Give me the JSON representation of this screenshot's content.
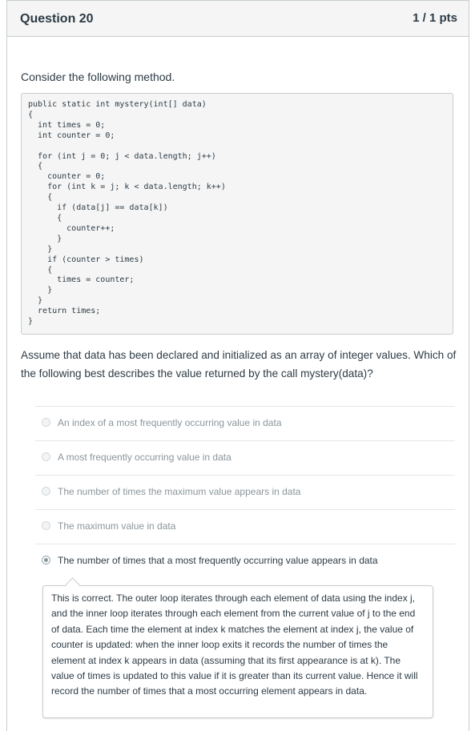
{
  "header": {
    "title": "Question 20",
    "points": "1 / 1 pts"
  },
  "question": {
    "intro": "Consider the following method.",
    "code": "public static int mystery(int[] data)\n{\n  int times = 0;\n  int counter = 0;\n\n  for (int j = 0; j < data.length; j++)\n  {\n    counter = 0;\n    for (int k = j; k < data.length; k++)\n    {\n      if (data[j] == data[k])\n      {\n        counter++;\n      }\n    }\n    if (counter > times)\n    {\n      times = counter;\n    }\n  }\n  return times;\n}",
    "prompt": "Assume that data has been declared and initialized as an array of integer values. Which of the following best describes the value returned by the call mystery(data)?"
  },
  "answers": [
    {
      "label": "An index of a most frequently occurring value in data",
      "selected": false
    },
    {
      "label": "A most frequently occurring value in data",
      "selected": false
    },
    {
      "label": "The number of times the maximum value appears in data",
      "selected": false
    },
    {
      "label": "The maximum value in data",
      "selected": false
    },
    {
      "label": "The number of times that a most frequently occurring value appears in data",
      "selected": true
    }
  ],
  "feedback": {
    "text": "This is correct. The outer loop iterates through each element of data using the index j, and the inner loop iterates through each element from the current value of j to the end of data. Each time the element at index k matches the element at index j, the value of counter is updated: when the inner loop exits it records the number of times the element at index k appears in data (assuming that its first appearance is at k). The value of times is updated to this value if it is greater than its current value. Hence it will record the number of times that a most occurring element appears in data."
  }
}
